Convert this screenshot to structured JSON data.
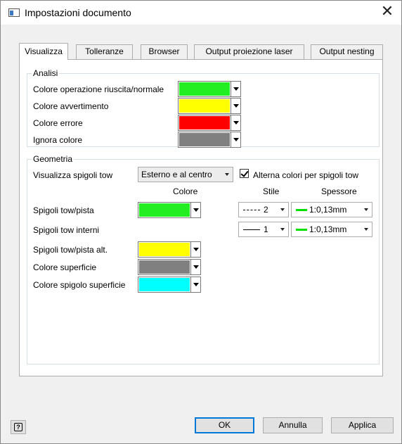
{
  "window": {
    "title": "Impostazioni documento",
    "close_symbol": "✕"
  },
  "tabs": [
    {
      "label": "Visualizza",
      "active": true
    },
    {
      "label": "Tolleranze",
      "active": false
    },
    {
      "label": "Browser",
      "active": false
    },
    {
      "label": "Output proiezione laser",
      "active": false
    },
    {
      "label": "Output nesting",
      "active": false
    }
  ],
  "analisi": {
    "group_label": "Analisi",
    "rows": [
      {
        "label": "Colore operazione riuscita/normale",
        "color": "#22ee22"
      },
      {
        "label": "Colore avvertimento",
        "color": "#ffff00"
      },
      {
        "label": "Colore errore",
        "color": "#ff0000"
      },
      {
        "label": "Ignora colore",
        "color": "#808080"
      }
    ]
  },
  "geometria": {
    "group_label": "Geometria",
    "visualizza_label": "Visualizza spigoli tow",
    "visualizza_value": "Esterno e al centro",
    "alterna_label": "Alterna colori per spigoli tow",
    "alterna_checked": true,
    "col_colore": "Colore",
    "col_stile": "Stile",
    "col_spessore": "Spessore",
    "rows": [
      {
        "label": "Spigoli tow/pista",
        "color": "#22ee22",
        "stile": "2",
        "spessore": "1:0,13mm"
      },
      {
        "label": "Spigoli tow interni",
        "stile": "1",
        "spessore": "1:0,13mm"
      },
      {
        "label": "Spigoli tow/pista alt.",
        "color": "#ffff00"
      },
      {
        "label": "Colore superficie",
        "color": "#808080"
      },
      {
        "label": "Colore spigolo superficie",
        "color": "#00ffff"
      }
    ]
  },
  "buttons": {
    "help": "?",
    "ok": "OK",
    "annulla": "Annulla",
    "applica": "Applica"
  }
}
